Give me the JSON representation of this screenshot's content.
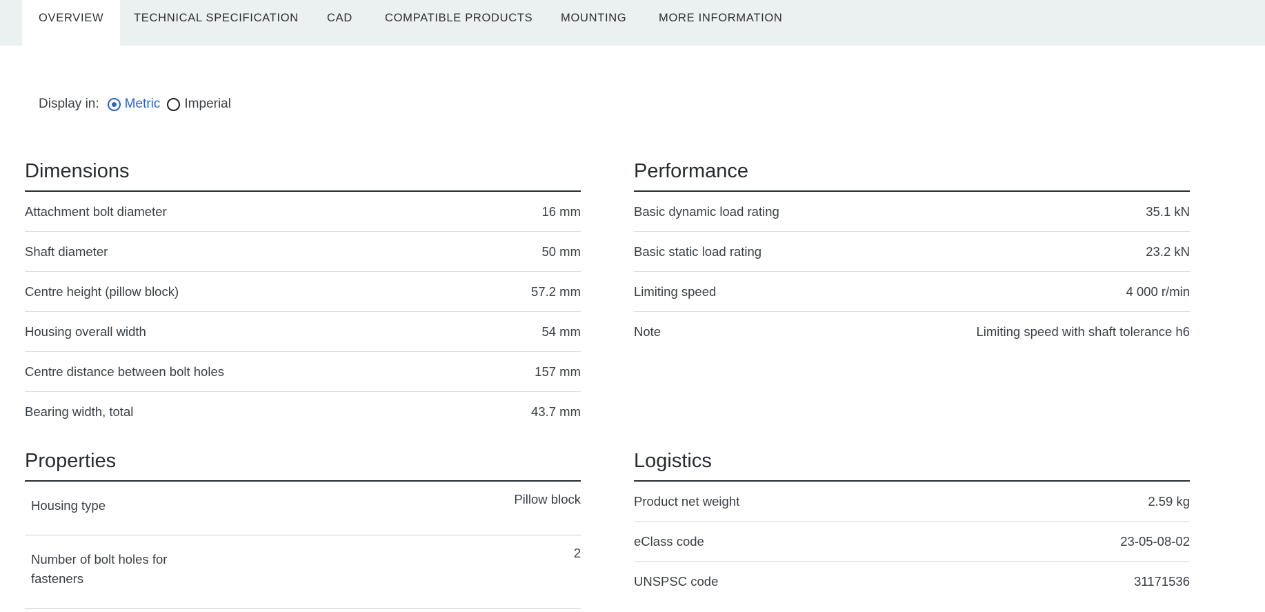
{
  "tabs": [
    {
      "label": "OVERVIEW"
    },
    {
      "label": "TECHNICAL SPECIFICATION"
    },
    {
      "label": "CAD"
    },
    {
      "label": "COMPATIBLE PRODUCTS"
    },
    {
      "label": "MOUNTING"
    },
    {
      "label": "MORE INFORMATION"
    }
  ],
  "display": {
    "label": "Display in:",
    "options": [
      {
        "label": "Metric",
        "selected": true
      },
      {
        "label": "Imperial",
        "selected": false
      }
    ]
  },
  "dimensions": {
    "title": "Dimensions",
    "rows": [
      {
        "k": "Attachment bolt diameter",
        "v": "16 mm"
      },
      {
        "k": "Shaft diameter",
        "v": "50 mm"
      },
      {
        "k": "Centre height (pillow block)",
        "v": "57.2 mm"
      },
      {
        "k": "Housing overall width",
        "v": "54 mm"
      },
      {
        "k": "Centre distance between bolt holes",
        "v": "157 mm"
      },
      {
        "k": "Bearing width, total",
        "v": "43.7 mm"
      }
    ]
  },
  "performance": {
    "title": "Performance",
    "rows": [
      {
        "k": "Basic dynamic load rating",
        "v": "35.1 kN"
      },
      {
        "k": "Basic static load rating",
        "v": "23.2 kN"
      },
      {
        "k": "Limiting speed",
        "v": "4 000 r/min"
      },
      {
        "k": "Note",
        "v": "Limiting speed with shaft tolerance h6"
      }
    ]
  },
  "properties": {
    "title": "Properties",
    "rows": [
      {
        "k": "Housing type",
        "v": "Pillow block"
      },
      {
        "k1": "Number of bolt holes for",
        "k2": "fasteners",
        "v": "2"
      }
    ]
  },
  "logistics": {
    "title": "Logistics",
    "rows": [
      {
        "k": "Product net weight",
        "v": "2.59 kg"
      },
      {
        "k": "eClass code",
        "v": "23-05-08-02"
      },
      {
        "k": "UNSPSC code",
        "v": "31171536"
      }
    ]
  },
  "colors": {
    "accent": "#2a62c9",
    "tabbar_bg": "#ebf0f0",
    "text": "#3a3f44"
  }
}
